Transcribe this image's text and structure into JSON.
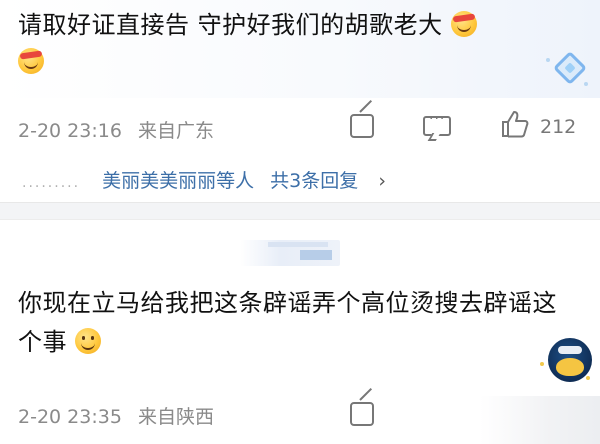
{
  "comment1": {
    "text": "请取好证直接告 守护好我们的胡歌老大",
    "emojis": [
      "grin-headband-emoji",
      "smile-emoji"
    ],
    "timestamp": "2-20 23:16",
    "location": "来自广东",
    "like_count": "212",
    "replies": {
      "names": "美丽美美丽丽等人",
      "count": "共3条回复",
      "chevron": "›"
    }
  },
  "comment2": {
    "text": "你现在立马给我把这条辟谣弄个高位烫搜去辟谣这个事",
    "emoji": "smile-emoji",
    "timestamp": "2-20 23:35",
    "location": "来自陕西"
  },
  "icons": {
    "share": "share-icon",
    "comment": "comment-icon",
    "like": "thumbs-up-icon",
    "badge": "diamond-badge-icon"
  },
  "colors": {
    "link": "#3d6fa8",
    "meta": "#8a8a8a",
    "text": "#111111"
  }
}
